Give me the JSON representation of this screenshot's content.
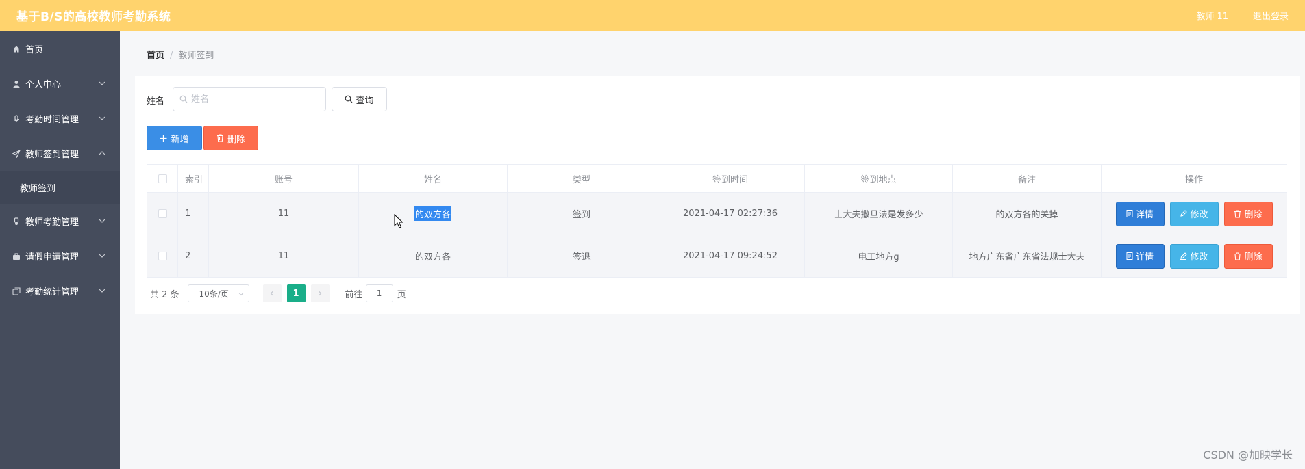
{
  "header": {
    "title": "基于B/S的高校教师考勤系统",
    "user": "教师 11",
    "logout": "退出登录"
  },
  "sidebar": {
    "items": [
      {
        "label": "首页",
        "icon": "home-icon",
        "expandable": false
      },
      {
        "label": "个人中心",
        "icon": "user-icon",
        "expandable": true
      },
      {
        "label": "考勤时间管理",
        "icon": "microphone-icon",
        "expandable": true
      },
      {
        "label": "教师签到管理",
        "icon": "send-icon",
        "expandable": true,
        "expanded": true
      },
      {
        "label": "教师考勤管理",
        "icon": "medal-icon",
        "expandable": true
      },
      {
        "label": "请假申请管理",
        "icon": "briefcase-icon",
        "expandable": true
      },
      {
        "label": "考勤统计管理",
        "icon": "copy-icon",
        "expandable": true
      }
    ],
    "submenu": {
      "label": "教师签到"
    }
  },
  "breadcrumb": {
    "home": "首页",
    "separator": "/",
    "current": "教师签到"
  },
  "search": {
    "label": "姓名",
    "placeholder": "姓名",
    "value": "",
    "query_label": "查询"
  },
  "actions": {
    "add_label": "新增",
    "delete_label": "删除"
  },
  "table": {
    "headers": [
      "索引",
      "账号",
      "姓名",
      "类型",
      "签到时间",
      "签到地点",
      "备注",
      "操作"
    ],
    "rows": [
      {
        "index": "1",
        "account": "11",
        "name": "的双方各",
        "type": "签到",
        "time": "2021-04-17 02:27:36",
        "location": "士大夫撒旦法是发多少",
        "remark": "的双方各的关掉"
      },
      {
        "index": "2",
        "account": "11",
        "name": "的双方各",
        "type": "签退",
        "time": "2021-04-17 09:24:52",
        "location": "电工地方g",
        "remark": "地方广东省广东省法规士大夫"
      }
    ],
    "row_actions": {
      "detail": "详情",
      "edit": "修改",
      "delete": "删除"
    }
  },
  "pagination": {
    "total": "共 2 条",
    "page_size": "10条/页",
    "current_page": "1",
    "goto_prefix": "前往",
    "goto_value": "1",
    "goto_suffix": "页"
  },
  "watermark": "CSDN @加映学长",
  "colors": {
    "header": "#ffd36d",
    "sidebar": "#454c5c",
    "primary": "#3a8ee6",
    "danger": "#fd6c4d",
    "info": "#46b5e8",
    "active_page": "#1aae89"
  }
}
